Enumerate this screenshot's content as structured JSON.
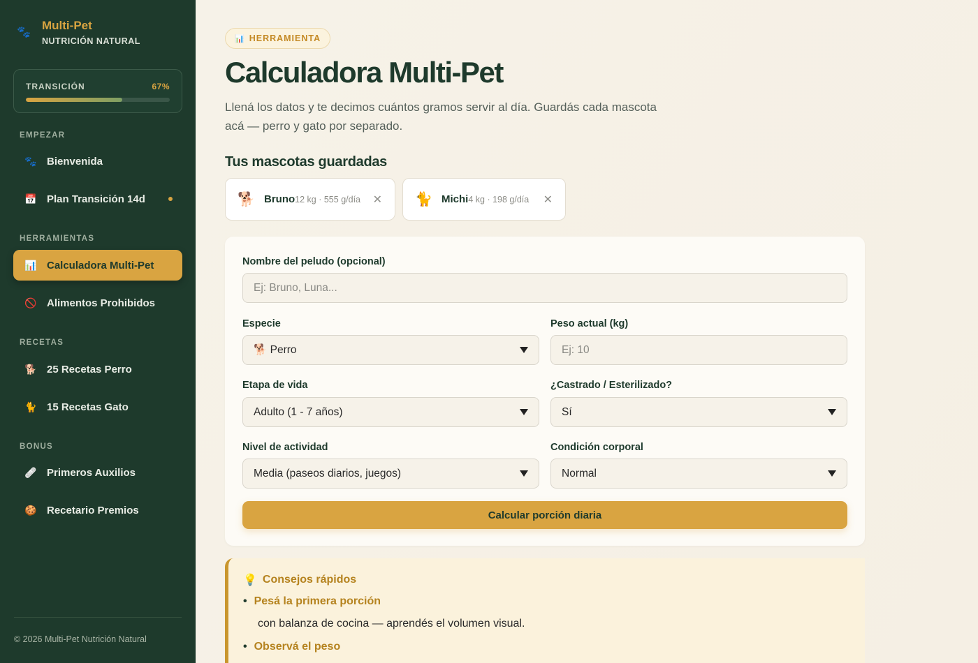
{
  "brand": {
    "title": "Multi-Pet",
    "subtitle": "NUTRICIÓN NATURAL",
    "icon": "paw-icon"
  },
  "progress": {
    "label": "TRANSICIÓN",
    "percent_text": "67%",
    "value": 0.67
  },
  "nav": {
    "sections": [
      "EMPEZAR",
      "HERRAMIENTAS",
      "RECETAS",
      "BONUS"
    ],
    "items": [
      {
        "label": "Bienvenida",
        "icon": "paw-icon",
        "glyph": "🐾"
      },
      {
        "label": "Plan Transición 14d",
        "icon": "calendar-icon",
        "glyph": "📅"
      },
      {
        "label": "Calculadora Multi-Pet",
        "icon": "chart-icon",
        "glyph": "📊"
      },
      {
        "label": "Alimentos Prohibidos",
        "icon": "prohibited-icon",
        "glyph": "🚫"
      },
      {
        "label": "25 Recetas Perro",
        "icon": "dog-icon",
        "glyph": "🐕"
      },
      {
        "label": "15 Recetas Gato",
        "icon": "cat-icon",
        "glyph": "🐈"
      },
      {
        "label": "Primeros Auxilios",
        "icon": "bandage-icon",
        "glyph": "🩹"
      },
      {
        "label": "Recetario Premios",
        "icon": "cookie-icon",
        "glyph": "🍪"
      }
    ]
  },
  "footer": "© 2026 Multi-Pet Nutrición Natural",
  "header": {
    "badge": "HERRAMIENTA",
    "title": "Calculadora Multi-Pet",
    "subtitle": "Llená los datos y te decimos cuántos gramos servir al día. Guardás cada mascota acá — perro y gato por separado."
  },
  "saved": {
    "title": "Tus mascotas guardadas",
    "pets": [
      {
        "name": "Bruno",
        "meta": "12 kg · 555 g/día",
        "icon": "dog-icon",
        "glyph": "🐕"
      },
      {
        "name": "Michi",
        "meta": "4 kg · 198 g/día",
        "icon": "cat-icon",
        "glyph": "🐈"
      }
    ]
  },
  "form": {
    "name_label": "Nombre del peludo (opcional)",
    "name_placeholder": "Ej: Bruno, Luna...",
    "species_label": "Especie",
    "species_value": "🐕 Perro",
    "weight_label": "Peso actual (kg)",
    "weight_placeholder": "Ej: 10",
    "stage_label": "Etapa de vida",
    "stage_value": "Adulto (1 - 7 años)",
    "neutered_label": "¿Castrado / Esterilizado?",
    "neutered_value": "Sí",
    "activity_label": "Nivel de actividad",
    "activity_value": "Media (paseos diarios, juegos)",
    "body_label": "Condición corporal",
    "body_value": "Normal",
    "submit": "Calcular porción diaria"
  },
  "tips": {
    "title": "Consejos rápidos",
    "items": [
      {
        "heading": "Pesá la primera porción",
        "text": "con balanza de cocina — aprendés el volumen visual."
      },
      {
        "heading": "Observá el peso"
      }
    ]
  },
  "colors": {
    "sidebar": "#1e3a2c",
    "accent": "#d9a441",
    "background": "#f6f1e7"
  }
}
